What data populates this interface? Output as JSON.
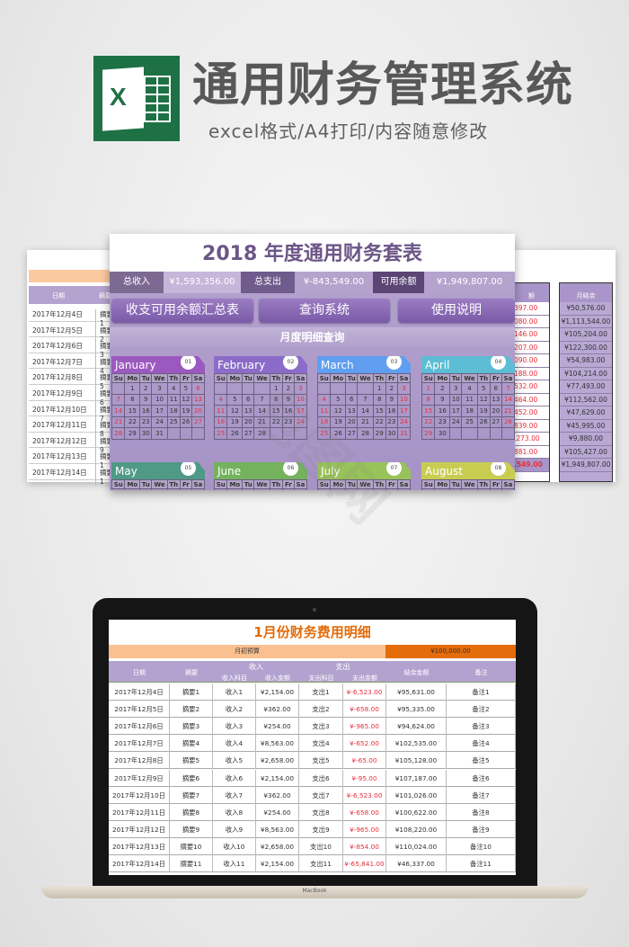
{
  "header": {
    "logo_letter": "X",
    "title": "通用财务管理系统",
    "subtitle": "excel格式/A4打印/内容随意修改"
  },
  "left_sheet": {
    "columns": [
      "日期",
      "摘要"
    ],
    "dates": [
      "2017年12月4日",
      "2017年12月5日",
      "2017年12月6日",
      "2017年12月7日",
      "2017年12月8日",
      "2017年12月9日",
      "2017年12月10日",
      "2017年12月11日",
      "2017年12月12日",
      "2017年12月13日",
      "2017年12月14日"
    ],
    "summary_partial": [
      "摘要1",
      "摘要2",
      "摘要3",
      "摘要4",
      "摘要5",
      "摘要6",
      "摘要7",
      "摘要8",
      "摘要9",
      "摘要1",
      "摘要1"
    ]
  },
  "right_sheet": {
    "col1_header": "额",
    "col1_values": [
      "397.00",
      "080.00",
      "146.00",
      "207.00",
      "090.00",
      "188.00",
      "532.00",
      "464.00",
      "452.00",
      "839.00",
      ",273.00",
      "881.00",
      ",549.00"
    ],
    "col2_header": "月结余",
    "col2_values": [
      "¥50,576.00",
      "¥1,113,544.00",
      "¥105,204.00",
      "¥122,300.00",
      "¥54,983.00",
      "¥104,214.00",
      "¥77,493.00",
      "¥112,562.00",
      "¥47,629.00",
      "¥45,995.00",
      "¥9,880.00",
      "¥105,427.00",
      "¥1,949,807.00"
    ]
  },
  "panel": {
    "title": "2018 年度通用财务套表",
    "stats": {
      "income_label": "总收入",
      "income": "¥1,593,356.00",
      "expense_label": "总支出",
      "expense": "¥-843,549.00",
      "balance_label": "可用余额",
      "balance": "¥1,949,807.00"
    },
    "buttons": {
      "summary": "收支可用余额汇总表",
      "query": "查询系统",
      "help": "使用说明"
    },
    "section_title": "月度明细查询",
    "weekdays": [
      "Su",
      "Mo",
      "Tu",
      "We",
      "Th",
      "Fr",
      "Sa"
    ],
    "months": [
      {
        "name": "January",
        "num": "01",
        "color": "#9b59c0",
        "start": 1,
        "days": 31
      },
      {
        "name": "February",
        "num": "02",
        "color": "#8a6cc8",
        "start": 4,
        "days": 28
      },
      {
        "name": "March",
        "num": "03",
        "color": "#5f9ef0",
        "start": 4,
        "days": 31
      },
      {
        "name": "April",
        "num": "04",
        "color": "#5cbdd4",
        "start": 0,
        "days": 30
      },
      {
        "name": "May",
        "num": "05",
        "color": "#4f9a86",
        "start": 2,
        "days": 31
      },
      {
        "name": "June",
        "num": "06",
        "color": "#74b25e",
        "start": 5,
        "days": 30
      },
      {
        "name": "July",
        "num": "07",
        "color": "#98c25a",
        "start": 0,
        "days": 31
      },
      {
        "name": "August",
        "num": "08",
        "color": "#c8cd52",
        "start": 3,
        "days": 31
      }
    ]
  },
  "laptop": {
    "brand": "MacBook",
    "sheet": {
      "title": "1月份财务费用明细",
      "budget_label": "月初预算",
      "budget_value": "¥100,000.00",
      "headers": {
        "date": "日期",
        "summary": "摘要",
        "income": "收入",
        "income_item": "收入科目",
        "income_amount": "收入金额",
        "expense": "支出",
        "expense_item": "支出科目",
        "expense_amount": "支出金额",
        "balance": "结余金额",
        "note": "备注"
      },
      "rows": [
        [
          "2017年12月4日",
          "摘要1",
          "收入1",
          "¥2,154.00",
          "支出1",
          "¥-6,523.00",
          "¥95,631.00",
          "备注1"
        ],
        [
          "2017年12月5日",
          "摘要2",
          "收入2",
          "¥362.00",
          "支出2",
          "¥-658.00",
          "¥95,335.00",
          "备注2"
        ],
        [
          "2017年12月6日",
          "摘要3",
          "收入3",
          "¥254.00",
          "支出3",
          "¥-965.00",
          "¥94,624.00",
          "备注3"
        ],
        [
          "2017年12月7日",
          "摘要4",
          "收入4",
          "¥8,563.00",
          "支出4",
          "¥-652.00",
          "¥102,535.00",
          "备注4"
        ],
        [
          "2017年12月8日",
          "摘要5",
          "收入5",
          "¥2,658.00",
          "支出5",
          "¥-65.00",
          "¥105,128.00",
          "备注5"
        ],
        [
          "2017年12月9日",
          "摘要6",
          "收入6",
          "¥2,154.00",
          "支出6",
          "¥-95.00",
          "¥107,187.00",
          "备注6"
        ],
        [
          "2017年12月10日",
          "摘要7",
          "收入7",
          "¥362.00",
          "支出7",
          "¥-6,523.00",
          "¥101,026.00",
          "备注7"
        ],
        [
          "2017年12月11日",
          "摘要8",
          "收入8",
          "¥254.00",
          "支出8",
          "¥-658.00",
          "¥100,622.00",
          "备注8"
        ],
        [
          "2017年12月12日",
          "摘要9",
          "收入9",
          "¥8,563.00",
          "支出9",
          "¥-965.00",
          "¥108,220.00",
          "备注9"
        ],
        [
          "2017年12月13日",
          "摘要10",
          "收入10",
          "¥2,658.00",
          "支出10",
          "¥-854.00",
          "¥110,024.00",
          "备注10"
        ],
        [
          "2017年12月14日",
          "摘要11",
          "收入11",
          "¥2,154.00",
          "支出11",
          "¥-65,841.00",
          "¥46,337.00",
          "备注11"
        ]
      ]
    }
  },
  "colors": {
    "excel_green": "#1e7145",
    "purple": "#7a5aa8",
    "orange": "#e46c0a",
    "expense_red": "#e8303c"
  }
}
